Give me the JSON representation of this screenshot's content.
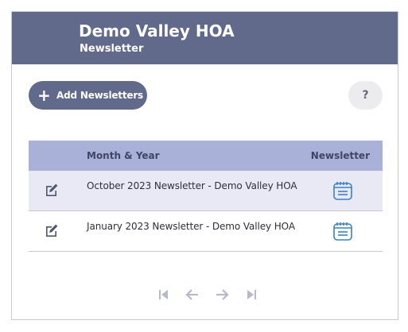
{
  "header": {
    "org_name": "Demo Valley HOA",
    "section": "Newsletter",
    "bg_color": "#626a8c"
  },
  "toolbar": {
    "add_icon": "plus-icon",
    "add_label": "Add Newsletters",
    "help_label": "?"
  },
  "table": {
    "columns": [
      "",
      "Month & Year",
      "Newsletter"
    ],
    "rows": [
      {
        "title": "October 2023 Newsletter - Demo Valley HOA",
        "edit_icon": "edit-icon",
        "newsletter_icon": "calendar-icon"
      },
      {
        "title": "January 2023 Newsletter - Demo Valley HOA",
        "edit_icon": "edit-icon",
        "newsletter_icon": "calendar-icon"
      }
    ],
    "header_color": "#aab1d8",
    "alt_row_color": "#e8e9f5"
  },
  "pager": {
    "buttons": [
      "first-page-icon",
      "prev-page-icon",
      "next-page-icon",
      "last-page-icon"
    ]
  }
}
